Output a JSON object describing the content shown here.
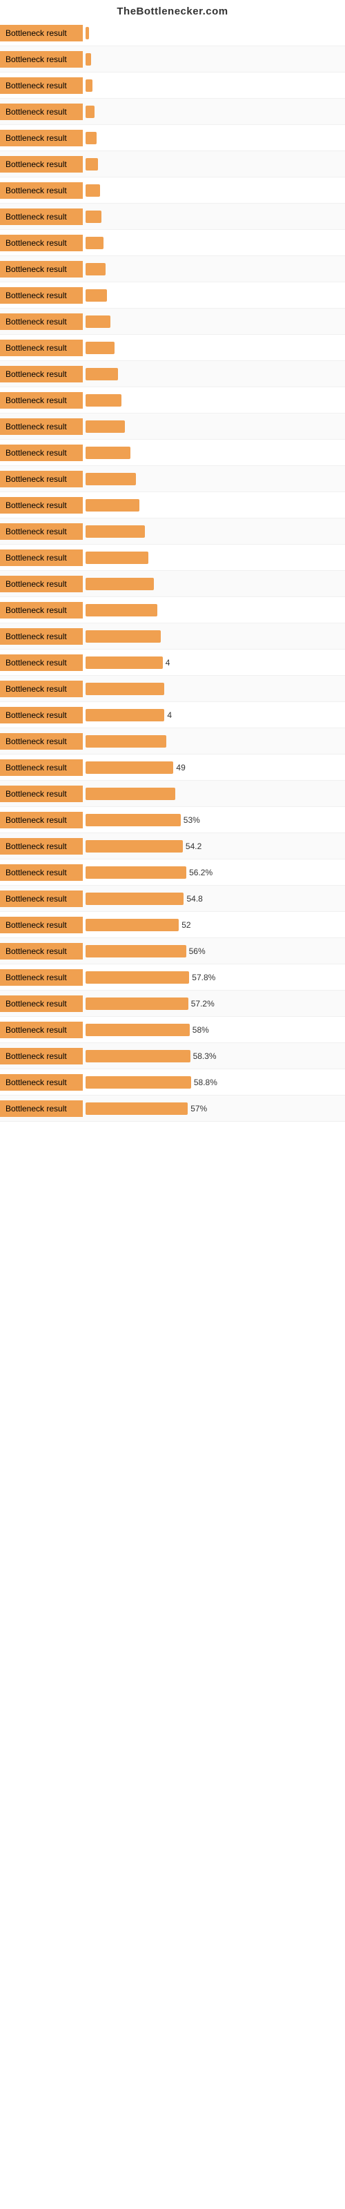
{
  "header": {
    "title": "TheBottlenecker.com"
  },
  "rows": [
    {
      "label": "Bottleneck result",
      "value": null,
      "bar_pct": 2
    },
    {
      "label": "Bottleneck result",
      "value": null,
      "bar_pct": 3
    },
    {
      "label": "Bottleneck result",
      "value": null,
      "bar_pct": 4
    },
    {
      "label": "Bottleneck result",
      "value": null,
      "bar_pct": 5
    },
    {
      "label": "Bottleneck result",
      "value": null,
      "bar_pct": 6
    },
    {
      "label": "Bottleneck result",
      "value": null,
      "bar_pct": 7
    },
    {
      "label": "Bottleneck result",
      "value": null,
      "bar_pct": 8
    },
    {
      "label": "Bottleneck result",
      "value": null,
      "bar_pct": 9
    },
    {
      "label": "Bottleneck result",
      "value": null,
      "bar_pct": 10
    },
    {
      "label": "Bottleneck result",
      "value": null,
      "bar_pct": 11
    },
    {
      "label": "Bottleneck result",
      "value": null,
      "bar_pct": 12
    },
    {
      "label": "Bottleneck result",
      "value": null,
      "bar_pct": 14
    },
    {
      "label": "Bottleneck result",
      "value": null,
      "bar_pct": 16
    },
    {
      "label": "Bottleneck result",
      "value": null,
      "bar_pct": 18
    },
    {
      "label": "Bottleneck result",
      "value": null,
      "bar_pct": 20
    },
    {
      "label": "Bottleneck result",
      "value": null,
      "bar_pct": 22
    },
    {
      "label": "Bottleneck result",
      "value": null,
      "bar_pct": 25
    },
    {
      "label": "Bottleneck result",
      "value": null,
      "bar_pct": 28
    },
    {
      "label": "Bottleneck result",
      "value": null,
      "bar_pct": 30
    },
    {
      "label": "Bottleneck result",
      "value": null,
      "bar_pct": 33
    },
    {
      "label": "Bottleneck result",
      "value": null,
      "bar_pct": 35
    },
    {
      "label": "Bottleneck result",
      "value": null,
      "bar_pct": 38
    },
    {
      "label": "Bottleneck result",
      "value": null,
      "bar_pct": 40
    },
    {
      "label": "Bottleneck result",
      "value": null,
      "bar_pct": 42
    },
    {
      "label": "Bottleneck result",
      "value": "4",
      "bar_pct": 43
    },
    {
      "label": "Bottleneck result",
      "value": null,
      "bar_pct": 44
    },
    {
      "label": "Bottleneck result",
      "value": "4",
      "bar_pct": 44
    },
    {
      "label": "Bottleneck result",
      "value": null,
      "bar_pct": 45
    },
    {
      "label": "Bottleneck result",
      "value": "49",
      "bar_pct": 49
    },
    {
      "label": "Bottleneck result",
      "value": null,
      "bar_pct": 50
    },
    {
      "label": "Bottleneck result",
      "value": "53%",
      "bar_pct": 53
    },
    {
      "label": "Bottleneck result",
      "value": "54.2",
      "bar_pct": 54.2
    },
    {
      "label": "Bottleneck result",
      "value": "56.2%",
      "bar_pct": 56.2
    },
    {
      "label": "Bottleneck result",
      "value": "54.8",
      "bar_pct": 54.8
    },
    {
      "label": "Bottleneck result",
      "value": "52",
      "bar_pct": 52
    },
    {
      "label": "Bottleneck result",
      "value": "56%",
      "bar_pct": 56
    },
    {
      "label": "Bottleneck result",
      "value": "57.8%",
      "bar_pct": 57.8
    },
    {
      "label": "Bottleneck result",
      "value": "57.2%",
      "bar_pct": 57.2
    },
    {
      "label": "Bottleneck result",
      "value": "58%",
      "bar_pct": 58
    },
    {
      "label": "Bottleneck result",
      "value": "58.3%",
      "bar_pct": 58.3
    },
    {
      "label": "Bottleneck result",
      "value": "58.8%",
      "bar_pct": 58.8
    },
    {
      "label": "Bottleneck result",
      "value": "57%",
      "bar_pct": 57
    }
  ]
}
